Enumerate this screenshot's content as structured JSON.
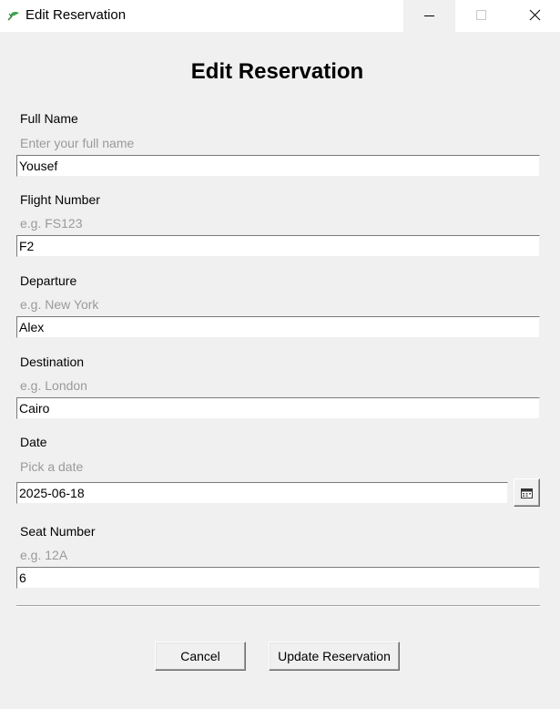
{
  "window": {
    "title": "Edit Reservation",
    "icon": "feather-app-icon",
    "controls": [
      "minimize-icon",
      "maximize-icon",
      "close-icon"
    ]
  },
  "form": {
    "heading": "Edit Reservation",
    "full_name": {
      "label": "Full Name",
      "hint": "Enter your full name",
      "value": "Yousef"
    },
    "flight_number": {
      "label": "Flight Number",
      "hint": "e.g. FS123",
      "value": "F2"
    },
    "departure": {
      "label": "Departure",
      "hint": "e.g. New York",
      "value": "Alex"
    },
    "destination": {
      "label": "Destination",
      "hint": "e.g. London",
      "value": "Cairo"
    },
    "date": {
      "label": "Date",
      "hint": "Pick a date",
      "value": "2025-06-18",
      "picker_icon": "calendar-icon"
    },
    "seat_number": {
      "label": "Seat Number",
      "hint": "e.g. 12A",
      "value": "6"
    }
  },
  "actions": {
    "cancel_label": "Cancel",
    "update_label": "Update Reservation"
  }
}
